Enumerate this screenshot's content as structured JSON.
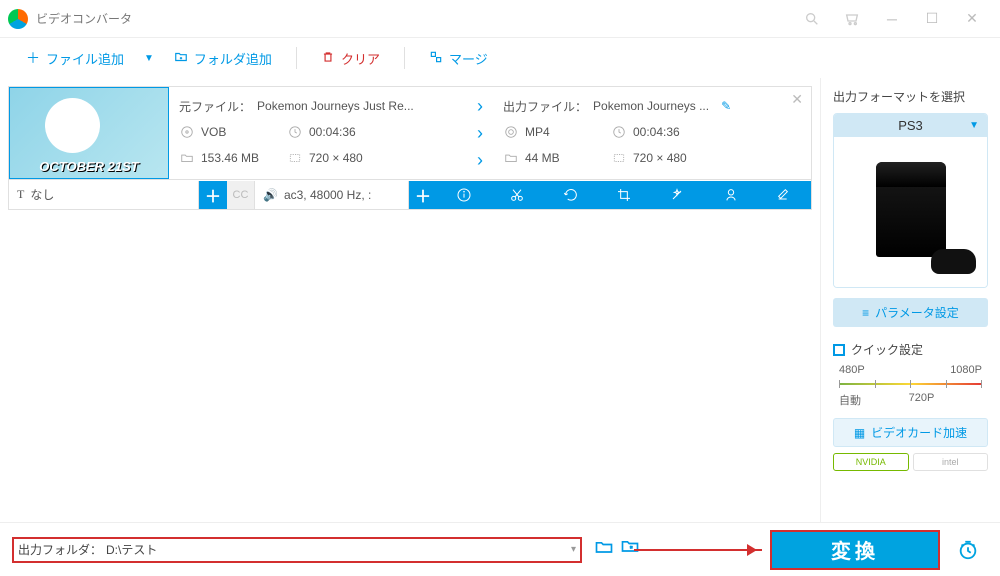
{
  "window": {
    "title": "ビデオコンバータ"
  },
  "toolbar": {
    "addFile": "ファイル追加",
    "addFolder": "フォルダ追加",
    "clear": "クリア",
    "merge": "マージ"
  },
  "item": {
    "thumbCaption": "OCTOBER 21ST",
    "source": {
      "label": "元ファイル：",
      "name": "Pokemon Journeys Just Re...",
      "format": "VOB",
      "duration": "00:04:36",
      "size": "153.46 MB",
      "resolution": "720 × 480"
    },
    "output": {
      "label": "出力ファイル：",
      "name": "Pokemon Journeys ...",
      "format": "MP4",
      "duration": "00:04:36",
      "size": "44 MB",
      "resolution": "720 × 480"
    },
    "subtitleTrack": "なし",
    "audioTrack": "ac3, 48000 Hz, :"
  },
  "right": {
    "header": "出力フォーマットを選択",
    "formatName": "PS3",
    "paramSettings": "パラメータ設定",
    "quick": "クイック設定",
    "res": {
      "a": "480P",
      "b": "1080P",
      "auto": "自動",
      "c": "720P"
    },
    "gpu": "ビデオカード加速",
    "nvidia": "NVIDIA",
    "intel": "intel"
  },
  "bottom": {
    "outLabel": "出力フォルダ：",
    "outPath": "D:\\テスト",
    "convert": "変換"
  }
}
